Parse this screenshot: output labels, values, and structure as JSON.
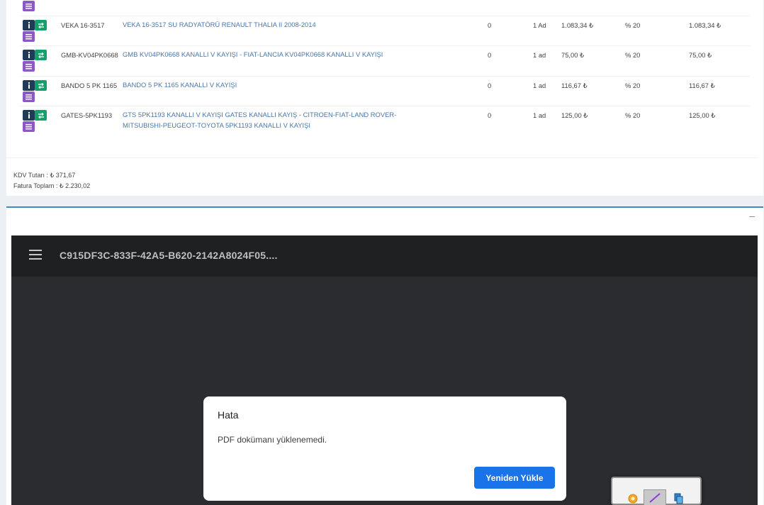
{
  "items": [
    {
      "code": "VEKA 16-3517",
      "description": "VEKA 16-3517 SU RADYATÖRÜ RENAULT THALIA II 2008-2014",
      "qty": "0",
      "unit": "1 Ad",
      "price": "1.083,34 ₺",
      "vat": "% 20",
      "total": "1.083,34 ₺"
    },
    {
      "code": "GMB-KV04PK0668",
      "description": "GMB KV04PK0668 KANALLI V KAYIŞI - FIAT-LANCIA KV04PK0668 KANALLI V KAYIŞI",
      "qty": "0",
      "unit": "1 ad",
      "price": "75,00 ₺",
      "vat": "% 20",
      "total": "75,00 ₺"
    },
    {
      "code": "BANDO 5 PK 1165",
      "description": "BANDO 5 PK 1165 KANALLI V KAYIŞI",
      "qty": "0",
      "unit": "1 ad",
      "price": "116,67 ₺",
      "vat": "% 20",
      "total": "116,67 ₺"
    },
    {
      "code": "GATES-5PK1193",
      "description": "GTS 5PK1193 KANALLI V KAYIŞI GATES KANALLI KAYIŞ - CITROEN-FIAT-LAND ROVER-MITSUBISHI-PEUGEOT-TOYOTA 5PK1193 KANALLI V KAYIŞI",
      "qty": "0",
      "unit": "1 ad",
      "price": "125,00 ₺",
      "vat": "% 20",
      "total": "125,00 ₺"
    }
  ],
  "totals": {
    "kdv": "KDV Tutarı : ₺ 371,67",
    "invoice": "Fatura Toplam : ₺ 2.230,02"
  },
  "panel": {
    "collapse_label": "–"
  },
  "viewer": {
    "title": "C915DF3C-833F-42A5-B620-2142A8024F05....",
    "dialog": {
      "title": "Hata",
      "message": "PDF dokümanı yüklenemedi.",
      "reload_label": "Yeniden Yükle"
    }
  },
  "icons": {
    "info": "info-icon",
    "swap": "swap-icon",
    "list": "list-icon",
    "menu": "hamburger-menu-icon"
  },
  "colors": {
    "info_button": "#1f3b57",
    "swap_button": "#14a06a",
    "list_button": "#8e57c8",
    "link_text": "#4a76a8",
    "panel_accent": "#3c8dbc",
    "reload_button": "#1a73e8"
  }
}
